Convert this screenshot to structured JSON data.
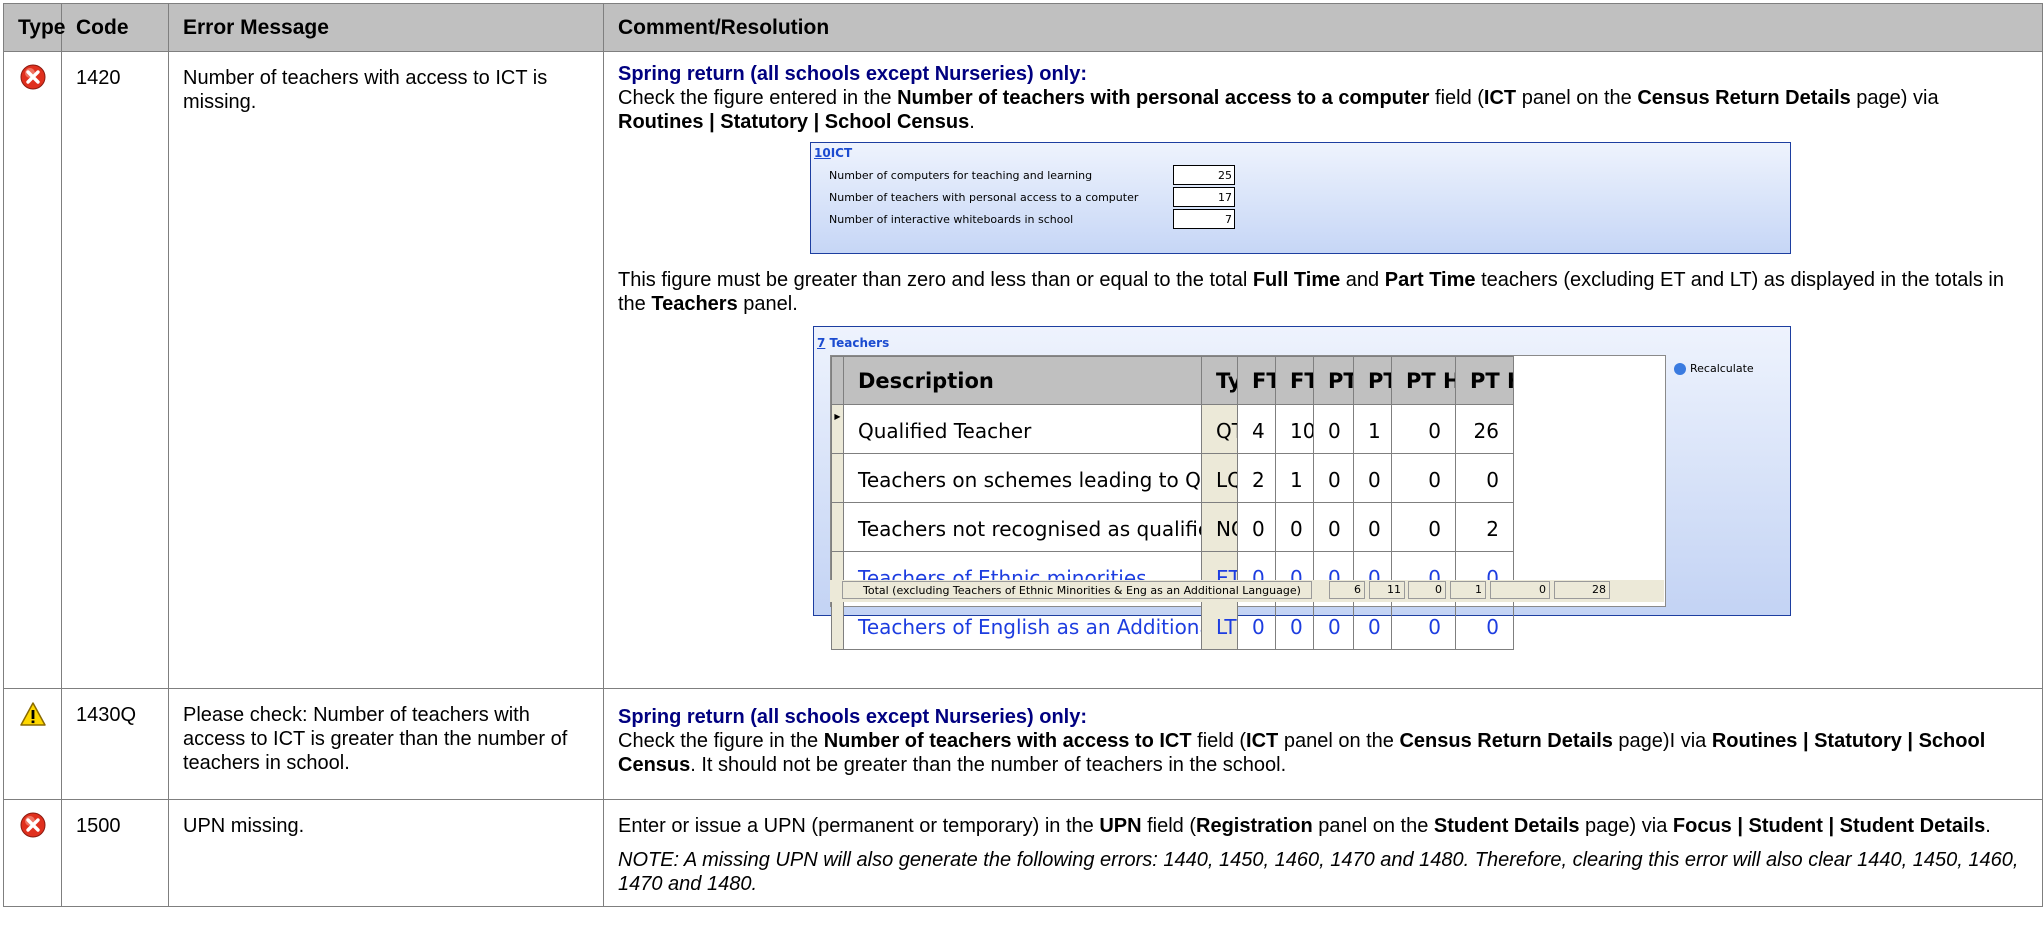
{
  "headers": {
    "type": "Type",
    "code": "Code",
    "error": "Error Message",
    "comment": "Comment/Resolution"
  },
  "rows": [
    {
      "icon": "error-icon",
      "code": "1420",
      "error": "Number of teachers with access to ICT is missing.",
      "spring": "Spring return (all schools except Nurseries) only:",
      "check1": "Check the figure entered in the ",
      "check_b1": "Number of teachers with personal access to a computer",
      "check2": " field (",
      "check_b2": "ICT",
      "check3": " panel on the ",
      "check_b3": "Census Return Details",
      "check4": " page) via ",
      "check_b4": "Routines | Statutory | School Census",
      "check5": ".",
      "must1": "This figure must be greater than zero and less than or equal to the total ",
      "must_b1": "Full Time",
      "must2": " and ",
      "must_b2": "Part Time",
      "must3": " teachers (excluding ET and LT) as displayed in the totals in the ",
      "must_b3": "Teachers",
      "must4": " panel."
    },
    {
      "icon": "warning-icon",
      "code": "1430Q",
      "error": "Please check: Number of teachers with access to ICT is greater than the number of teachers in school.",
      "spring": "Spring return (all schools except Nurseries) only:",
      "t1": "Check the figure in the ",
      "b1": "Number of teachers with access to ICT",
      "t2": " field (",
      "b2": "ICT",
      "t3": " panel on the ",
      "b3": "Census Return Details",
      "t4": " page)I via ",
      "b4": "Routines | Statutory | School Census",
      "t5": ". It should not be greater than the number of teachers in the school."
    },
    {
      "icon": "error-icon",
      "code": "1500",
      "error": "UPN missing.",
      "t1": "Enter or issue a UPN (permanent or temporary) in the ",
      "b1": "UPN",
      "t2": " field (",
      "b2": "Registration",
      "t3": " panel on the ",
      "b3": "Student Details",
      "t4": " page) via ",
      "b4": "Focus | Student | Student Details",
      "t5": ".",
      "note": "NOTE: A missing UPN will also generate the following errors: 1440, 1450, 1460, 1470 and 1480. Therefore, clearing this error will also clear 1440, 1450, 1460, 1470 and 1480."
    }
  ],
  "ict_panel": {
    "num": "10",
    "title": "ICT",
    "fields": [
      {
        "label": "Number of computers for teaching and learning",
        "value": "25"
      },
      {
        "label": "Number of teachers with personal access to a computer",
        "value": "17"
      },
      {
        "label": "Number of interactive whiteboards in school",
        "value": "7"
      }
    ]
  },
  "teachers_panel": {
    "num": "7",
    "title": "Teachers",
    "columns": [
      "Description",
      "Type",
      "FT(M)",
      "FT(F)",
      "PT(M)",
      "PT(F)",
      "PT Hrs(M)",
      "PT Hrs(F)"
    ],
    "rows": [
      [
        "Qualified Teacher",
        "QT",
        "4",
        "10",
        "0",
        "1",
        "0",
        "26"
      ],
      [
        "Teachers on schemes leading to Qualified Teacher Status",
        "LQ",
        "2",
        "1",
        "0",
        "0",
        "0",
        "0"
      ],
      [
        "Teachers not recognised as qualified",
        "NQ",
        "0",
        "0",
        "0",
        "0",
        "0",
        "2"
      ],
      [
        "Teachers of Ethnic minorities",
        "ET",
        "0",
        "0",
        "0",
        "0",
        "0",
        "0"
      ],
      [
        "Teachers of English as an Additional Language",
        "LT",
        "0",
        "0",
        "0",
        "0",
        "0",
        "0"
      ]
    ],
    "total_label": "Total (excluding Teachers of Ethnic Minorities & Eng as an Additional Language)",
    "totals": [
      "6",
      "11",
      "0",
      "1",
      "0",
      "28"
    ],
    "recalculate": "Recalculate"
  }
}
